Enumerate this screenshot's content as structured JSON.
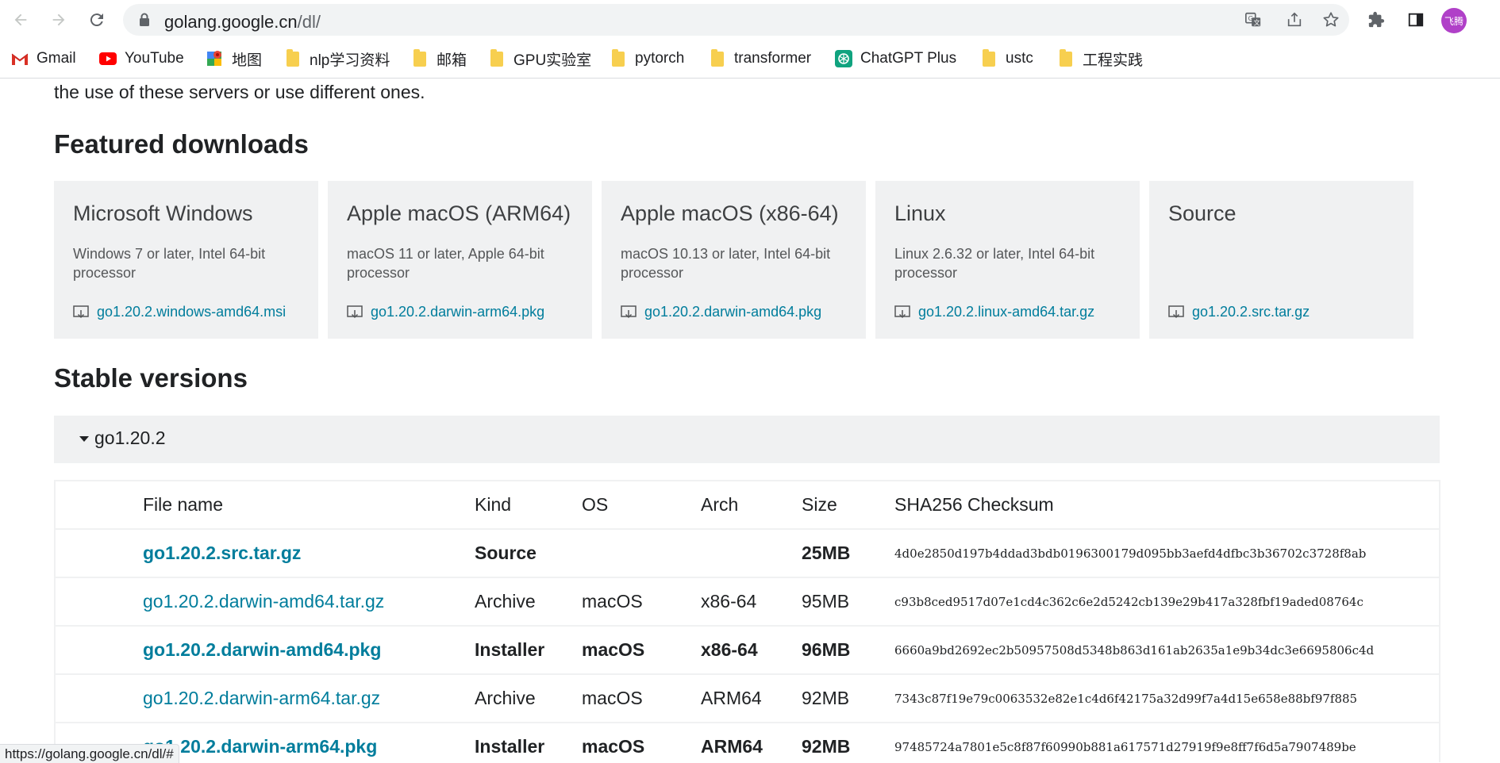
{
  "browser": {
    "url_host": "golang.google.cn",
    "url_path": "/dl/",
    "avatar_text": "飞腾"
  },
  "bookmarks": [
    {
      "label": "Gmail",
      "icon": "gmail-icon"
    },
    {
      "label": "YouTube",
      "icon": "youtube-icon"
    },
    {
      "label": "地图",
      "icon": "maps-icon"
    },
    {
      "label": "nlp学习资料",
      "icon": "folder-icon"
    },
    {
      "label": "邮箱",
      "icon": "folder-icon"
    },
    {
      "label": "GPU实验室",
      "icon": "folder-icon"
    },
    {
      "label": "pytorch",
      "icon": "folder-icon"
    },
    {
      "label": "transformer",
      "icon": "folder-icon"
    },
    {
      "label": "ChatGPT Plus",
      "icon": "chatgpt-icon"
    },
    {
      "label": "ustc",
      "icon": "folder-icon"
    },
    {
      "label": "工程实践",
      "icon": "folder-icon"
    }
  ],
  "page": {
    "intro_text": "the use of these servers or use different ones.",
    "featured_heading": "Featured downloads",
    "stable_heading": "Stable versions",
    "featured": [
      {
        "title": "Microsoft Windows",
        "desc": "Windows 7 or later, Intel 64-bit processor",
        "file": "go1.20.2.windows-amd64.msi"
      },
      {
        "title": "Apple macOS (ARM64)",
        "desc": "macOS 11 or later, Apple 64-bit processor",
        "file": "go1.20.2.darwin-arm64.pkg"
      },
      {
        "title": "Apple macOS (x86-64)",
        "desc": "macOS 10.13 or later, Intel 64-bit processor",
        "file": "go1.20.2.darwin-amd64.pkg"
      },
      {
        "title": "Linux",
        "desc": "Linux 2.6.32 or later, Intel 64-bit processor",
        "file": "go1.20.2.linux-amd64.tar.gz"
      },
      {
        "title": "Source",
        "desc": "",
        "file": "go1.20.2.src.tar.gz"
      }
    ],
    "version_label": "go1.20.2",
    "table": {
      "headers": {
        "file": "File name",
        "kind": "Kind",
        "os": "OS",
        "arch": "Arch",
        "size": "Size",
        "sha": "SHA256 Checksum"
      },
      "rows": [
        {
          "file": "go1.20.2.src.tar.gz",
          "kind": "Source",
          "os": "",
          "arch": "",
          "size": "25MB",
          "sha": "4d0e2850d197b4ddad3bdb0196300179d095bb3aefd4dfbc3b36702c3728f8ab",
          "bold": true
        },
        {
          "file": "go1.20.2.darwin-amd64.tar.gz",
          "kind": "Archive",
          "os": "macOS",
          "arch": "x86-64",
          "size": "95MB",
          "sha": "c93b8ced9517d07e1cd4c362c6e2d5242cb139e29b417a328fbf19aded08764c",
          "bold": false
        },
        {
          "file": "go1.20.2.darwin-amd64.pkg",
          "kind": "Installer",
          "os": "macOS",
          "arch": "x86-64",
          "size": "96MB",
          "sha": "6660a9bd2692ec2b50957508d5348b863d161ab2635a1e9b34dc3e6695806c4d",
          "bold": true
        },
        {
          "file": "go1.20.2.darwin-arm64.tar.gz",
          "kind": "Archive",
          "os": "macOS",
          "arch": "ARM64",
          "size": "92MB",
          "sha": "7343c87f19e79c0063532e82e1c4d6f42175a32d99f7a4d15e658e88bf97f885",
          "bold": false
        },
        {
          "file": "go1.20.2.darwin-arm64.pkg",
          "kind": "Installer",
          "os": "macOS",
          "arch": "ARM64",
          "size": "92MB",
          "sha": "97485724a7801e5c8f87f60990b881a617571d27919f9e8ff7f6d5a7907489be",
          "bold": true
        }
      ]
    }
  },
  "status_bar": "https://golang.google.cn/dl/#",
  "colors": {
    "link": "#007d9c",
    "card_bg": "#f0f1f2"
  }
}
